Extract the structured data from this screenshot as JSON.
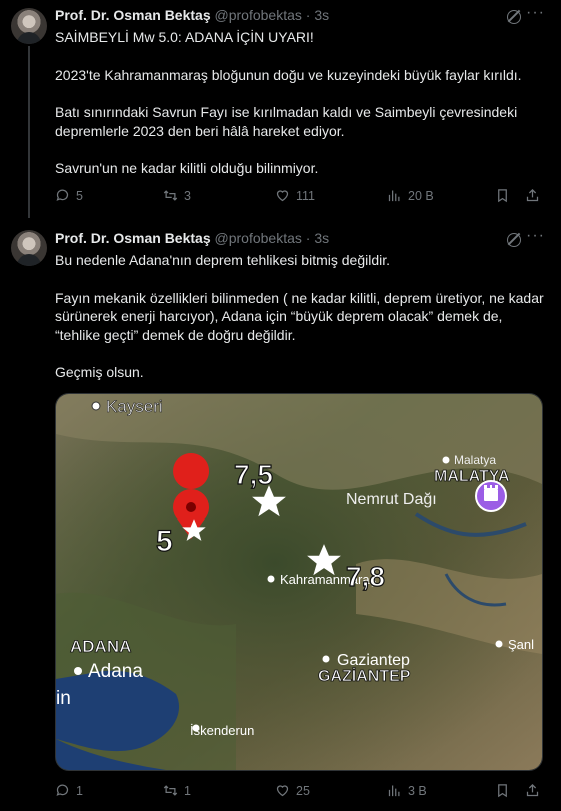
{
  "posts": [
    {
      "author_name": "Prof. Dr. Osman Bektaş",
      "handle": "@profobektas",
      "separator": "·",
      "time": "3s",
      "paragraphs": [
        "SAİMBEYLİ Mw 5.0: ADANA İÇİN UYARI!",
        "2023'te Kahramanmaraş bloğunun doğu ve kuzeyindeki büyük faylar kırıldı.",
        "Batı sınırındaki Savrun Fayı ise kırılmadan kaldı ve Saimbeyli çevresindeki depremlerle 2023 den beri hâlâ hareket ediyor.",
        "Savrun'un ne kadar kilitli olduğu bilinmiyor."
      ],
      "stats": {
        "replies": "5",
        "reposts": "3",
        "likes": "111",
        "views": "20 B"
      }
    },
    {
      "author_name": "Prof. Dr. Osman Bektaş",
      "handle": "@profobektas",
      "separator": "·",
      "time": "3s",
      "paragraphs": [
        "Bu nedenle Adana'nın deprem tehlikesi bitmiş değildir.",
        "Fayın mekanik özellikleri bilinmeden ( ne kadar kilitli, deprem üretiyor, ne kadar sürünerek enerji harcıyor), Adana için “büyük deprem olacak” demek de, “tehlike geçti” demek de doğru değildir.",
        "Geçmiş olsun."
      ],
      "stats": {
        "replies": "1",
        "reposts": "1",
        "likes": "25",
        "views": "3 B"
      }
    }
  ],
  "map": {
    "place_labels": {
      "kayseri": "Kayseri",
      "malatya_small": "Malatya",
      "malatya_caps": "MALATYA",
      "nemrut": "Nemrut Dağı",
      "kahramanmaras": "Kahramanmaraş",
      "adana_caps": "ADANA",
      "adana": "Adana",
      "gaziantep": "Gaziantep",
      "gaziantep_caps": "GAZİANTEP",
      "iskenderun": "İskenderun",
      "sanliurfa": "Şanl",
      "edge_left": "in"
    },
    "magnitudes": {
      "quake_a": "7,5",
      "quake_b": "7,8",
      "quake_c": "5"
    },
    "colors": {
      "pin": "#e0201b",
      "poi": "#9b5de5",
      "star": "#ffffff",
      "sea": "#1e3f73"
    }
  },
  "icons": [
    "reply-icon",
    "repost-icon",
    "like-icon",
    "views-icon",
    "bookmark-icon",
    "share-icon",
    "grok-icon",
    "more-icon"
  ]
}
